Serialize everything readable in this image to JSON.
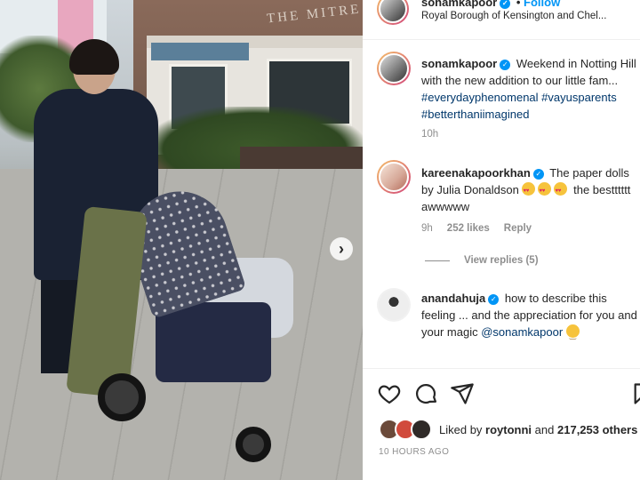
{
  "post": {
    "username": "sonamkapoor",
    "follow_label": "Follow",
    "location": "Royal Borough of Kensington and Chel...",
    "caption_text": "Weekend in Notting Hill with the new addition to our little fam...",
    "hashtags": [
      "#everydayphenomenal",
      "#vayusparents",
      "#betterthaniimagined"
    ],
    "caption_time": "10h"
  },
  "comments": [
    {
      "username": "kareenakapoorkhan",
      "text": "The paper dolls by Julia Donaldson",
      "text2": "the bestttttt awwwww",
      "time": "9h",
      "likes": "252 likes",
      "reply": "Reply",
      "view_replies": "View replies (5)"
    },
    {
      "username": "anandahuja",
      "text": "how to describe this feeling ... and the appreciation for you and your magic",
      "mention": "@sonamkapoor"
    }
  ],
  "likes": {
    "prefix": "Liked by",
    "user": "roytonni",
    "joiner": "and",
    "count": "217,253 others"
  },
  "timestamp": "10 HOURS AGO",
  "photo": {
    "shop_sign": "THE MITRE",
    "next_arrow": "›"
  },
  "icons": [
    "heart-icon",
    "comment-icon",
    "share-icon",
    "bookmark-icon",
    "verified-icon",
    "next-arrow-icon"
  ],
  "colors": {
    "link": "#00376b",
    "follow": "#0095f6",
    "muted": "#8e8e8e"
  }
}
